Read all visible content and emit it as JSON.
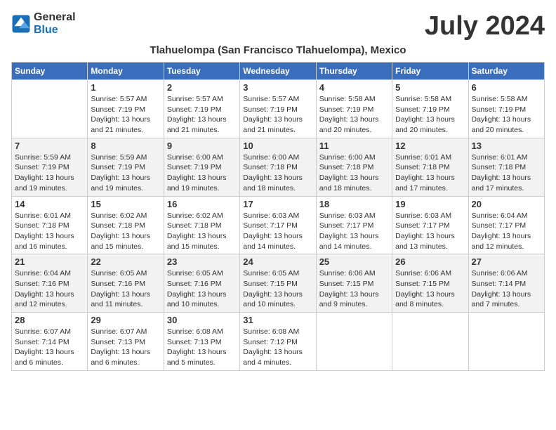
{
  "logo": {
    "line1": "General",
    "line2": "Blue"
  },
  "title": "July 2024",
  "location": "Tlahuelompa (San Francisco Tlahuelompa), Mexico",
  "days_of_week": [
    "Sunday",
    "Monday",
    "Tuesday",
    "Wednesday",
    "Thursday",
    "Friday",
    "Saturday"
  ],
  "weeks": [
    [
      {
        "date": "",
        "info": ""
      },
      {
        "date": "1",
        "info": "Sunrise: 5:57 AM\nSunset: 7:19 PM\nDaylight: 13 hours\nand 21 minutes."
      },
      {
        "date": "2",
        "info": "Sunrise: 5:57 AM\nSunset: 7:19 PM\nDaylight: 13 hours\nand 21 minutes."
      },
      {
        "date": "3",
        "info": "Sunrise: 5:57 AM\nSunset: 7:19 PM\nDaylight: 13 hours\nand 21 minutes."
      },
      {
        "date": "4",
        "info": "Sunrise: 5:58 AM\nSunset: 7:19 PM\nDaylight: 13 hours\nand 20 minutes."
      },
      {
        "date": "5",
        "info": "Sunrise: 5:58 AM\nSunset: 7:19 PM\nDaylight: 13 hours\nand 20 minutes."
      },
      {
        "date": "6",
        "info": "Sunrise: 5:58 AM\nSunset: 7:19 PM\nDaylight: 13 hours\nand 20 minutes."
      }
    ],
    [
      {
        "date": "7",
        "info": "Sunrise: 5:59 AM\nSunset: 7:19 PM\nDaylight: 13 hours\nand 19 minutes."
      },
      {
        "date": "8",
        "info": "Sunrise: 5:59 AM\nSunset: 7:19 PM\nDaylight: 13 hours\nand 19 minutes."
      },
      {
        "date": "9",
        "info": "Sunrise: 6:00 AM\nSunset: 7:19 PM\nDaylight: 13 hours\nand 19 minutes."
      },
      {
        "date": "10",
        "info": "Sunrise: 6:00 AM\nSunset: 7:18 PM\nDaylight: 13 hours\nand 18 minutes."
      },
      {
        "date": "11",
        "info": "Sunrise: 6:00 AM\nSunset: 7:18 PM\nDaylight: 13 hours\nand 18 minutes."
      },
      {
        "date": "12",
        "info": "Sunrise: 6:01 AM\nSunset: 7:18 PM\nDaylight: 13 hours\nand 17 minutes."
      },
      {
        "date": "13",
        "info": "Sunrise: 6:01 AM\nSunset: 7:18 PM\nDaylight: 13 hours\nand 17 minutes."
      }
    ],
    [
      {
        "date": "14",
        "info": "Sunrise: 6:01 AM\nSunset: 7:18 PM\nDaylight: 13 hours\nand 16 minutes."
      },
      {
        "date": "15",
        "info": "Sunrise: 6:02 AM\nSunset: 7:18 PM\nDaylight: 13 hours\nand 15 minutes."
      },
      {
        "date": "16",
        "info": "Sunrise: 6:02 AM\nSunset: 7:18 PM\nDaylight: 13 hours\nand 15 minutes."
      },
      {
        "date": "17",
        "info": "Sunrise: 6:03 AM\nSunset: 7:17 PM\nDaylight: 13 hours\nand 14 minutes."
      },
      {
        "date": "18",
        "info": "Sunrise: 6:03 AM\nSunset: 7:17 PM\nDaylight: 13 hours\nand 14 minutes."
      },
      {
        "date": "19",
        "info": "Sunrise: 6:03 AM\nSunset: 7:17 PM\nDaylight: 13 hours\nand 13 minutes."
      },
      {
        "date": "20",
        "info": "Sunrise: 6:04 AM\nSunset: 7:17 PM\nDaylight: 13 hours\nand 12 minutes."
      }
    ],
    [
      {
        "date": "21",
        "info": "Sunrise: 6:04 AM\nSunset: 7:16 PM\nDaylight: 13 hours\nand 12 minutes."
      },
      {
        "date": "22",
        "info": "Sunrise: 6:05 AM\nSunset: 7:16 PM\nDaylight: 13 hours\nand 11 minutes."
      },
      {
        "date": "23",
        "info": "Sunrise: 6:05 AM\nSunset: 7:16 PM\nDaylight: 13 hours\nand 10 minutes."
      },
      {
        "date": "24",
        "info": "Sunrise: 6:05 AM\nSunset: 7:15 PM\nDaylight: 13 hours\nand 10 minutes."
      },
      {
        "date": "25",
        "info": "Sunrise: 6:06 AM\nSunset: 7:15 PM\nDaylight: 13 hours\nand 9 minutes."
      },
      {
        "date": "26",
        "info": "Sunrise: 6:06 AM\nSunset: 7:15 PM\nDaylight: 13 hours\nand 8 minutes."
      },
      {
        "date": "27",
        "info": "Sunrise: 6:06 AM\nSunset: 7:14 PM\nDaylight: 13 hours\nand 7 minutes."
      }
    ],
    [
      {
        "date": "28",
        "info": "Sunrise: 6:07 AM\nSunset: 7:14 PM\nDaylight: 13 hours\nand 6 minutes."
      },
      {
        "date": "29",
        "info": "Sunrise: 6:07 AM\nSunset: 7:13 PM\nDaylight: 13 hours\nand 6 minutes."
      },
      {
        "date": "30",
        "info": "Sunrise: 6:08 AM\nSunset: 7:13 PM\nDaylight: 13 hours\nand 5 minutes."
      },
      {
        "date": "31",
        "info": "Sunrise: 6:08 AM\nSunset: 7:12 PM\nDaylight: 13 hours\nand 4 minutes."
      },
      {
        "date": "",
        "info": ""
      },
      {
        "date": "",
        "info": ""
      },
      {
        "date": "",
        "info": ""
      }
    ]
  ]
}
